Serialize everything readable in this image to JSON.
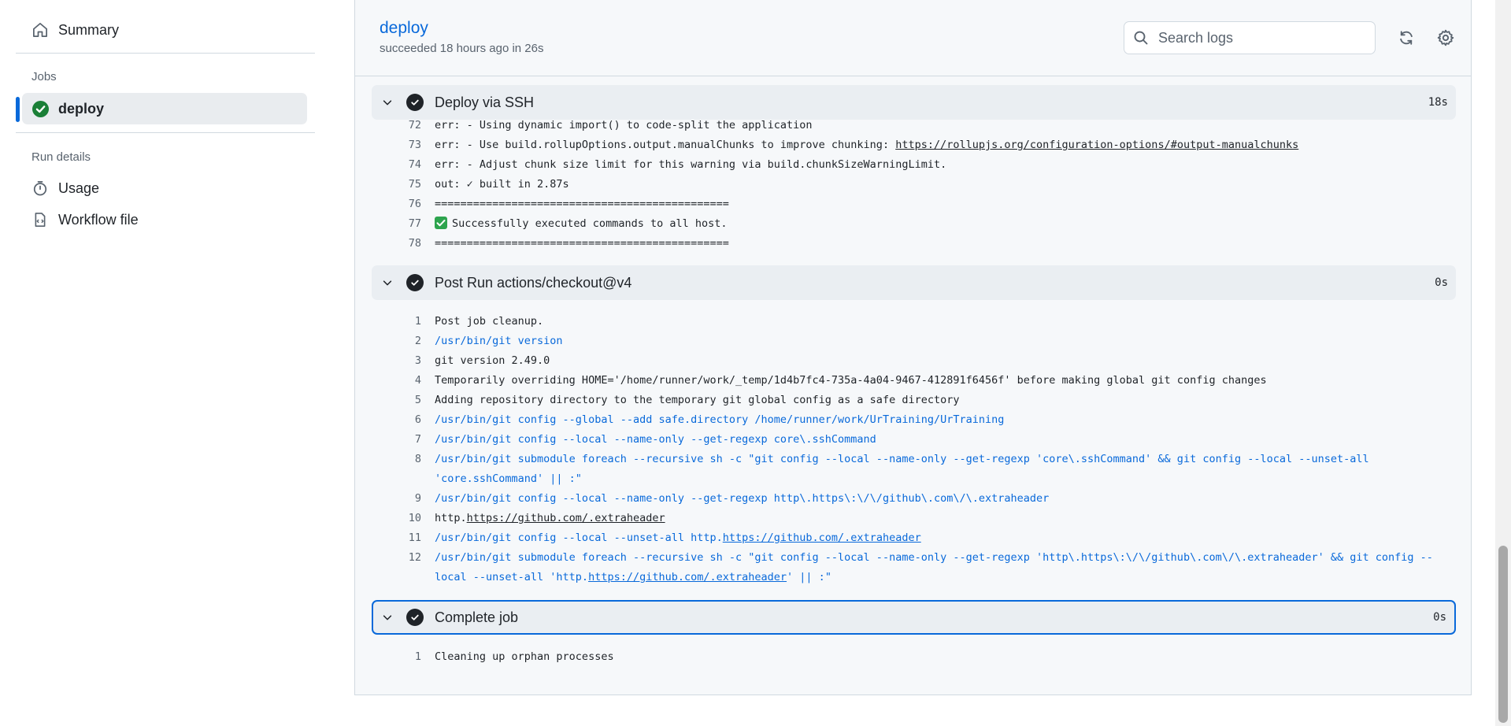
{
  "sidebar": {
    "summary_label": "Summary",
    "jobs_heading": "Jobs",
    "job_label": "deploy",
    "run_details_heading": "Run details",
    "usage_label": "Usage",
    "workflow_file_label": "Workflow file"
  },
  "job": {
    "title": "deploy",
    "subtitle": "succeeded 18 hours ago in 26s"
  },
  "search": {
    "placeholder": "Search logs"
  },
  "steps": [
    {
      "name": "Deploy via SSH",
      "duration": "18s",
      "lines": [
        {
          "n": "72",
          "text": "err: - Using dynamic import() to code-split the application"
        },
        {
          "n": "73",
          "text": "err: - Use build.rollupOptions.output.manualChunks to improve chunking: ",
          "link": "https://rollupjs.org/configuration-options/#output-manualchunks"
        },
        {
          "n": "74",
          "text": "err: - Adjust chunk size limit for this warning via build.chunkSizeWarningLimit."
        },
        {
          "n": "75",
          "text": "out: ✓ built in 2.87s"
        },
        {
          "n": "76",
          "text": "=============================================="
        },
        {
          "n": "77",
          "text": "Successfully executed commands to all host."
        },
        {
          "n": "78",
          "text": "=============================================="
        }
      ]
    },
    {
      "name": "Post Run actions/checkout@v4",
      "duration": "0s",
      "lines": [
        {
          "n": "1",
          "text": "Post job cleanup."
        },
        {
          "n": "2",
          "text": "/usr/bin/git version"
        },
        {
          "n": "3",
          "text": "git version 2.49.0"
        },
        {
          "n": "4",
          "text": "Temporarily overriding HOME='/home/runner/work/_temp/1d4b7fc4-735a-4a04-9467-412891f6456f' before making global git config changes"
        },
        {
          "n": "5",
          "text": "Adding repository directory to the temporary git global config as a safe directory"
        },
        {
          "n": "6",
          "text": "/usr/bin/git config --global --add safe.directory /home/runner/work/UrTraining/UrTraining"
        },
        {
          "n": "7",
          "text": "/usr/bin/git config --local --name-only --get-regexp core\\.sshCommand"
        },
        {
          "n": "8",
          "text": "/usr/bin/git submodule foreach --recursive sh -c \"git config --local --name-only --get-regexp 'core\\.sshCommand' && git config --local --unset-all",
          "text2": "'core.sshCommand' || :\""
        },
        {
          "n": "9",
          "text": "/usr/bin/git config --local --name-only --get-regexp http\\.https\\:\\/\\/github\\.com\\/\\.extraheader"
        },
        {
          "n": "10",
          "pre": "http.",
          "link": "https://github.com/.extraheader"
        },
        {
          "n": "11",
          "pre": "/usr/bin/git config --local --unset-all http.",
          "link": "https://github.com/.extraheader"
        },
        {
          "n": "12",
          "text": "/usr/bin/git submodule foreach --recursive sh -c \"git config --local --name-only --get-regexp 'http\\.https\\:\\/\\/github\\.com\\/\\.extraheader' && git config --",
          "pre2": "local --unset-all 'http.",
          "link2": "https://github.com/.extraheader",
          "post2": "' || :\""
        }
      ]
    },
    {
      "name": "Complete job",
      "duration": "0s",
      "lines": [
        {
          "n": "1",
          "text": "Cleaning up orphan processes"
        }
      ]
    }
  ]
}
